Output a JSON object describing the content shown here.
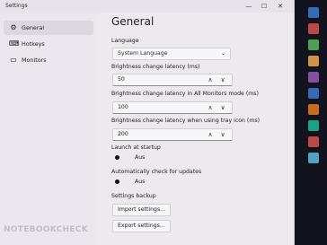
{
  "window": {
    "title": "Settings",
    "minimize": "—",
    "maximize": "☐",
    "close": "✕"
  },
  "sidebar": {
    "items": [
      {
        "label": "General",
        "icon": "gear-icon",
        "glyph": "⚙"
      },
      {
        "label": "Hotkeys",
        "icon": "keyboard-icon",
        "glyph": "⌨"
      },
      {
        "label": "Monitors",
        "icon": "monitor-icon",
        "glyph": "▭"
      }
    ]
  },
  "main": {
    "title": "General",
    "language": {
      "label": "Language",
      "value": "System Language",
      "chevron": "⌄"
    },
    "brightness_latency": {
      "label": "Brightness change latency (ms)",
      "value": "50"
    },
    "brightness_latency_all": {
      "label": "Brightness change latency in All Monitors mode (ms)",
      "value": "100"
    },
    "brightness_latency_tray": {
      "label": "Brightness change latency when using tray icon (ms)",
      "value": "200"
    },
    "launch_at_startup": {
      "label": "Launch at startup",
      "state": "Aus"
    },
    "auto_updates": {
      "label": "Automatically check for updates",
      "state": "Aus"
    },
    "backup": {
      "label": "Settings backup",
      "import": "Import settings...",
      "export": "Export settings..."
    },
    "spinner": {
      "up": "∧",
      "down": "∨"
    }
  },
  "watermark": "NOTEBOOKCHECK",
  "colors": {
    "window_bg": "#ece9ef",
    "desktop_bg": "#12131c",
    "selected_item": "#dcd8e0"
  }
}
